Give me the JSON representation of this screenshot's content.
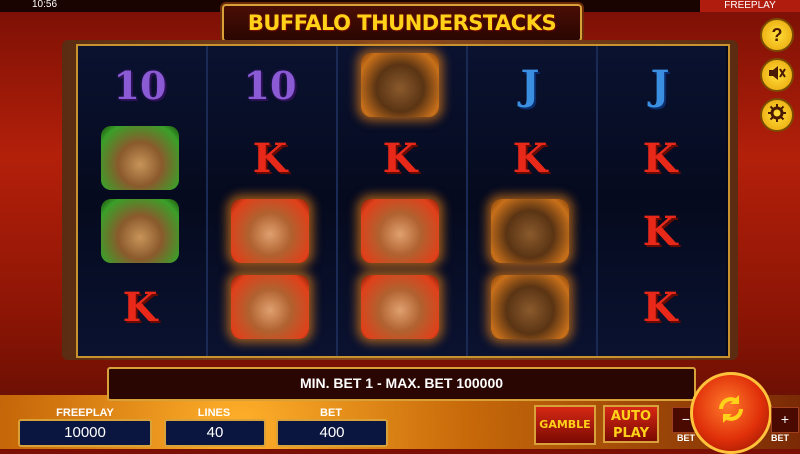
{
  "status_bar": {
    "time": "10:56",
    "mode": "FREEPLAY"
  },
  "game": {
    "title": "BUFFALO THUNDERSTACKS"
  },
  "reels": [
    [
      "10",
      "deer",
      "deer",
      "K"
    ],
    [
      "10",
      "K",
      "cougar",
      "cougar"
    ],
    [
      "bear",
      "K",
      "cougar",
      "cougar"
    ],
    [
      "J",
      "K",
      "bear",
      "bear"
    ],
    [
      "J",
      "K",
      "K",
      "K"
    ]
  ],
  "side_buttons": {
    "help": "?",
    "sound": "sound-icon",
    "settings": "gear-icon"
  },
  "info": {
    "message": "MIN. BET 1 - MAX. BET 100000"
  },
  "bottom": {
    "freeplay_label": "FREEPLAY",
    "freeplay_value": "10000",
    "lines_label": "LINES",
    "lines_value": "40",
    "bet_label": "BET",
    "bet_value": "400",
    "gamble_label": "GAMBLE",
    "autoplay_label_1": "AUTO",
    "autoplay_label_2": "PLAY",
    "bet_minus": "−",
    "bet_minus_label": "BET",
    "bet_plus": "+",
    "bet_plus_label": "BET"
  }
}
